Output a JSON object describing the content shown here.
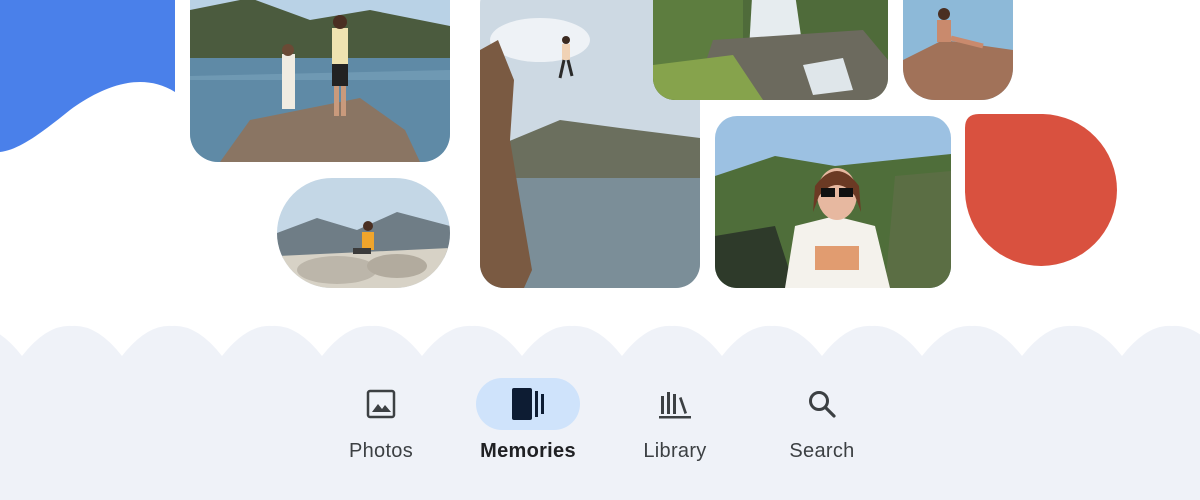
{
  "colors": {
    "blue_shape": "#4a80ea",
    "red_shape": "#d9513f",
    "bar_background": "#eff2f8",
    "active_pill": "#cfe3fb",
    "icon": "#3c4043",
    "active_icon": "#0d1c33"
  },
  "photos": [
    {
      "name": "photo-lake-two-hikers",
      "subject": "two people standing on rocks by a lake"
    },
    {
      "name": "photo-man-sitting-rocks",
      "subject": "man sitting on rocks above a canyon"
    },
    {
      "name": "photo-cliff-jump",
      "subject": "person jumping off a cliff into a lake"
    },
    {
      "name": "photo-waterfall",
      "subject": "waterfall over mossy rocks"
    },
    {
      "name": "photo-woman-on-rock",
      "subject": "woman sitting on a rock"
    },
    {
      "name": "photo-woman-sunglasses",
      "subject": "woman with sunglasses outdoors"
    }
  ],
  "nav": {
    "items": [
      {
        "label": "Photos",
        "icon": "photo-icon",
        "active": false
      },
      {
        "label": "Memories",
        "icon": "memories-icon",
        "active": true
      },
      {
        "label": "Library",
        "icon": "library-icon",
        "active": false
      },
      {
        "label": "Search",
        "icon": "search-icon",
        "active": false
      }
    ]
  }
}
